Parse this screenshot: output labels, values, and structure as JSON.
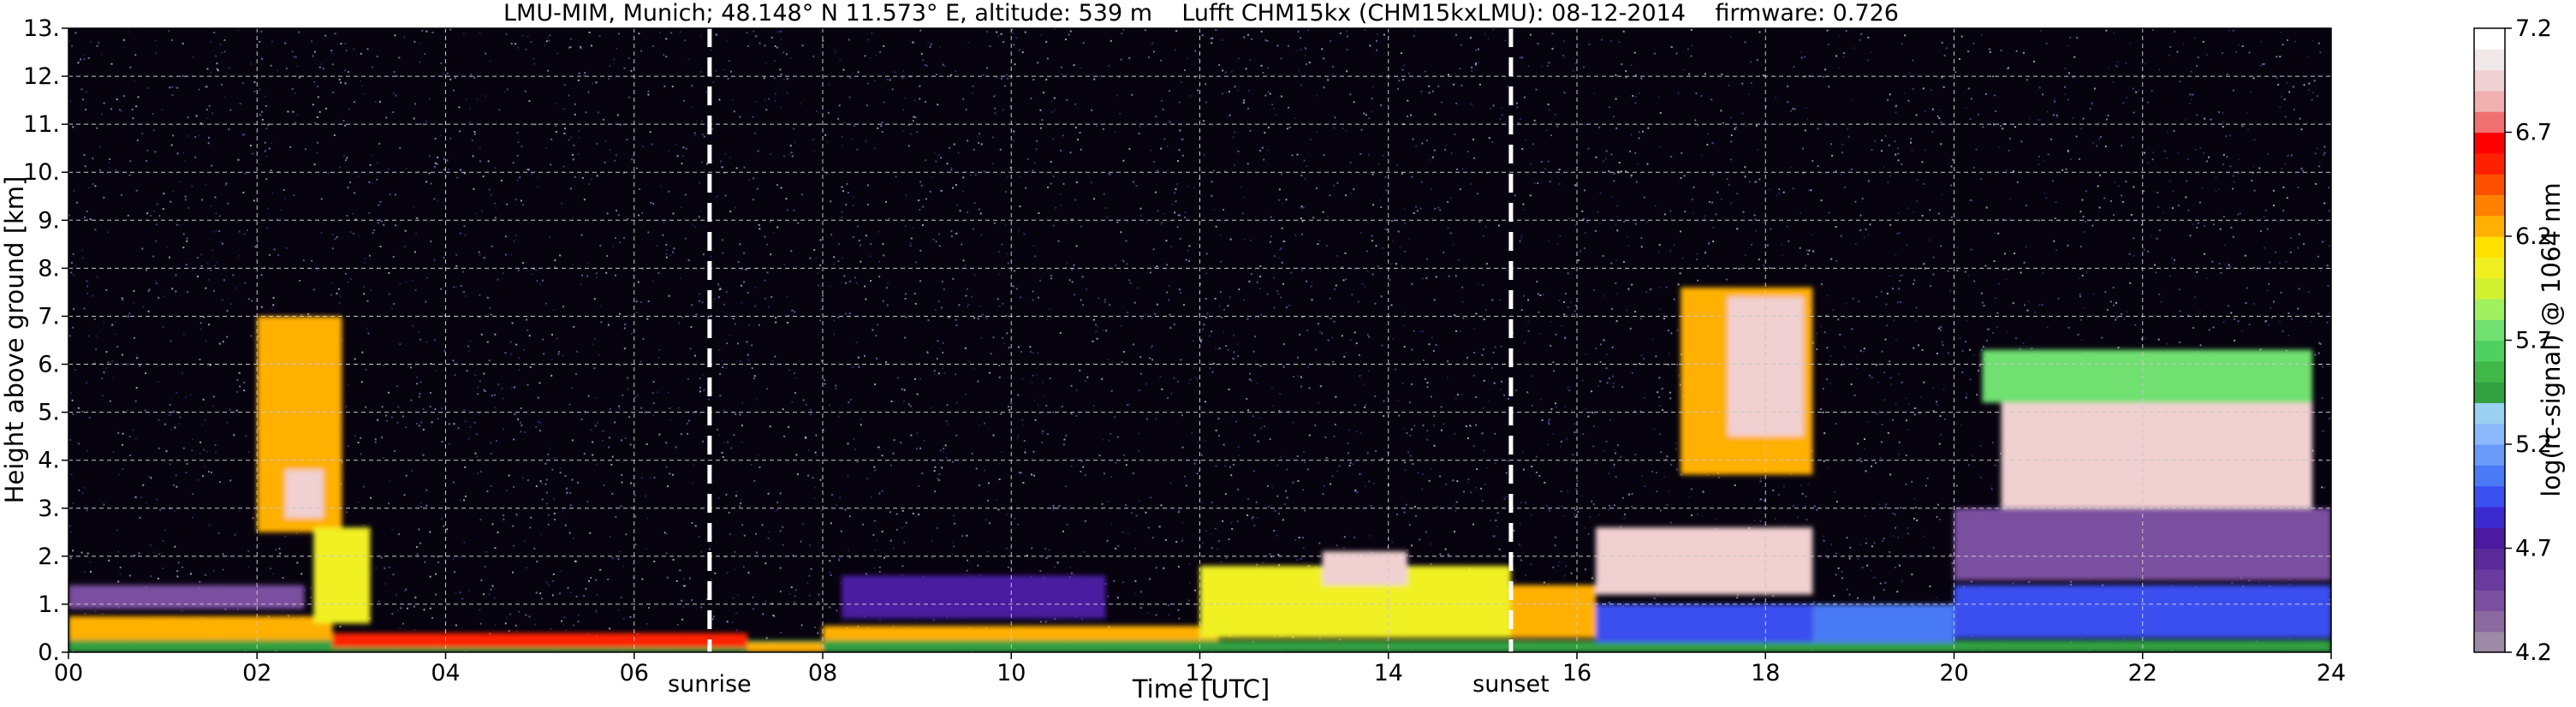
{
  "chart_data": {
    "type": "heatmap",
    "title": "LMU-MIM, Munich; 48.148° N 11.573° E, altitude: 539 m    Lufft CHM15kx (CHM15kxLMU): 08-12-2014    firmware: 0.726",
    "xlabel": "Time [UTC]",
    "ylabel": "Height above ground [km]",
    "xlim": [
      0,
      24
    ],
    "ylim": [
      0,
      13
    ],
    "x_ticks": [
      "00",
      "02",
      "04",
      "06",
      "08",
      "10",
      "12",
      "14",
      "16",
      "18",
      "20",
      "22",
      "24"
    ],
    "y_ticks": [
      "0.",
      "1.",
      "2.",
      "3.",
      "4.",
      "5.",
      "6.",
      "7.",
      "8.",
      "9.",
      "10.",
      "11.",
      "12.",
      "13."
    ],
    "grid": true,
    "colorbar": {
      "label": "log(rc-signal) @ 1064 nm",
      "range": [
        4.2,
        7.2
      ],
      "ticks": [
        "4.2",
        "4.7",
        "5.2",
        "5.7",
        "6.2",
        "6.7",
        "7.2"
      ],
      "colors": [
        "#9c8aa6",
        "#8a6aa0",
        "#7a4fa0",
        "#6a3a9e",
        "#5a2a9a",
        "#4a1aa0",
        "#3a2ad0",
        "#3a50f0",
        "#4a7af5",
        "#6a9af8",
        "#8ab8fa",
        "#9ad0f0",
        "#30a040",
        "#40b848",
        "#50d060",
        "#70e070",
        "#a0f060",
        "#d0f030",
        "#f0f020",
        "#ffe000",
        "#ffb000",
        "#ff8000",
        "#ff5000",
        "#ff2000",
        "#ff0000",
        "#f07070",
        "#f0b0b0",
        "#f0d0d0",
        "#f0e8e8",
        "#ffffff"
      ]
    },
    "annotations": [
      {
        "label": "sunrise",
        "x": 6.8
      },
      {
        "label": "sunset",
        "x": 15.3
      }
    ],
    "features": [
      {
        "x": [
          0,
          24
        ],
        "y": [
          0,
          0.25
        ],
        "level": 5.4
      },
      {
        "x": [
          0,
          2.8
        ],
        "y": [
          0.25,
          0.75
        ],
        "level": 6.2
      },
      {
        "x": [
          2.8,
          7.2
        ],
        "y": [
          0.1,
          0.4
        ],
        "level": 6.6
      },
      {
        "x": [
          7.2,
          8.0
        ],
        "y": [
          0,
          0.2
        ],
        "level": 6.2
      },
      {
        "x": [
          8.0,
          12.2
        ],
        "y": [
          0.25,
          0.55
        ],
        "level": 6.3
      },
      {
        "x": [
          8.2,
          11.0
        ],
        "y": [
          0.7,
          1.6
        ],
        "level": 4.8
      },
      {
        "x": [
          12.0,
          15.3
        ],
        "y": [
          0.3,
          1.8
        ],
        "level": 6.0
      },
      {
        "x": [
          13.3,
          14.2
        ],
        "y": [
          1.4,
          2.1
        ],
        "level": 6.9
      },
      {
        "x": [
          15.3,
          16.2
        ],
        "y": [
          0.3,
          1.4
        ],
        "level": 6.3
      },
      {
        "x": [
          16.2,
          18.5
        ],
        "y": [
          0.2,
          1.0
        ],
        "level": 5.0
      },
      {
        "x": [
          16.2,
          18.5
        ],
        "y": [
          1.2,
          2.6
        ],
        "level": 6.9
      },
      {
        "x": [
          18.5,
          20.0
        ],
        "y": [
          0.2,
          1.0
        ],
        "level": 5.1
      },
      {
        "x": [
          20.0,
          24.0
        ],
        "y": [
          0.3,
          1.4
        ],
        "level": 4.9
      },
      {
        "x": [
          20.0,
          24.0
        ],
        "y": [
          1.5,
          3.0
        ],
        "level": 4.5
      },
      {
        "x": [
          17.1,
          18.5
        ],
        "y": [
          3.7,
          7.6
        ],
        "level": 6.3
      },
      {
        "x": [
          17.6,
          18.4
        ],
        "y": [
          4.5,
          7.4
        ],
        "level": 6.9
      },
      {
        "x": [
          20.5,
          23.8
        ],
        "y": [
          3.0,
          5.3
        ],
        "level": 6.9
      },
      {
        "x": [
          20.3,
          23.8
        ],
        "y": [
          5.2,
          6.3
        ],
        "level": 5.8
      },
      {
        "x": [
          2.0,
          2.9
        ],
        "y": [
          2.5,
          7.0
        ],
        "level": 6.2
      },
      {
        "x": [
          2.3,
          2.7
        ],
        "y": [
          2.8,
          3.8
        ],
        "level": 6.9
      },
      {
        "x": [
          2.6,
          3.2
        ],
        "y": [
          0.6,
          2.6
        ],
        "level": 6.0
      },
      {
        "x": [
          0,
          2.5
        ],
        "y": [
          0.9,
          1.4
        ],
        "level": 4.5
      }
    ]
  }
}
